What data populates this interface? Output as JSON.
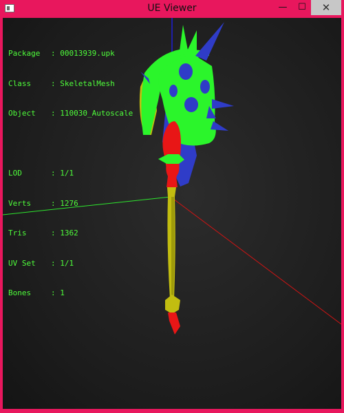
{
  "window": {
    "title": "UE Viewer",
    "buttons": {
      "minimize": "—",
      "maximize": "☐",
      "close": "✕"
    }
  },
  "info": {
    "group1": [
      {
        "label": "Package",
        "value": "00013939.upk"
      },
      {
        "label": "Class",
        "value": "SkeletalMesh"
      },
      {
        "label": "Object",
        "value": "110030_Autoscale"
      }
    ],
    "group2": [
      {
        "label": "LOD",
        "value": "1/1"
      },
      {
        "label": "Verts",
        "value": "1276"
      },
      {
        "label": "Tris",
        "value": "1362"
      },
      {
        "label": "UV Set",
        "value": "1/1"
      },
      {
        "label": "Bones",
        "value": "1"
      }
    ]
  },
  "colors": {
    "frame": "#e8175d",
    "info_text": "#4fff3b",
    "axis_x": "#d11414",
    "axis_y": "#2eea2e",
    "axis_z": "#1f1fd6",
    "mesh_green": "#2bf52b",
    "mesh_blue": "#2f3cc8",
    "mesh_red": "#e81616",
    "mesh_yellow": "#c2bd10"
  }
}
